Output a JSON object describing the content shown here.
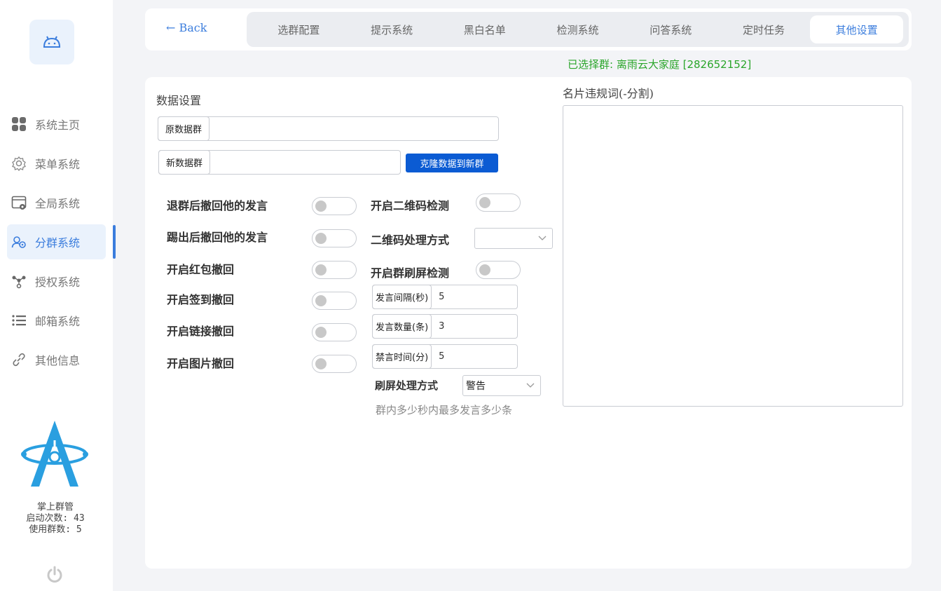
{
  "sidebar": {
    "items": [
      {
        "label": "系统主页",
        "icon": "grid-icon"
      },
      {
        "label": "菜单系统",
        "icon": "gear-icon"
      },
      {
        "label": "全局系统",
        "icon": "window-settings-icon"
      },
      {
        "label": "分群系统",
        "icon": "users-icon",
        "active": true
      },
      {
        "label": "授权系统",
        "icon": "network-icon"
      },
      {
        "label": "邮箱系统",
        "icon": "list-icon"
      },
      {
        "label": "其他信息",
        "icon": "link-icon"
      }
    ],
    "brand": {
      "name": "掌上群管",
      "launch_count": "启动次数: 43",
      "group_count": "使用群数: 5"
    }
  },
  "header": {
    "back_label": "← Back",
    "tabs": [
      "选群配置",
      "提示系统",
      "黑白名单",
      "检测系统",
      "问答系统",
      "定时任务",
      "其他设置"
    ],
    "active_tab": "其他设置",
    "selected_group": "已选择群: 离雨云大家庭 [282652152]"
  },
  "main": {
    "section_title": "数据设置",
    "source_group": {
      "label": "原数据群",
      "value": ""
    },
    "new_group": {
      "label": "新数据群",
      "value": ""
    },
    "clone_button": "克隆数据到新群",
    "left_toggles": [
      {
        "label": "退群后撤回他的发言",
        "on": false
      },
      {
        "label": "踢出后撤回他的发言",
        "on": false
      },
      {
        "label": "开启红包撤回",
        "on": false
      },
      {
        "label": "开启签到撤回",
        "on": false
      },
      {
        "label": "开启链接撤回",
        "on": false
      },
      {
        "label": "开启图片撤回",
        "on": false
      }
    ],
    "qr_detect_label": "开启二维码检测",
    "qr_mode_label": "二维码处理方式",
    "qr_mode_value": "",
    "flood_detect_label": "开启群刷屏检测",
    "interval": {
      "label": "发言间隔(秒)",
      "value": "5"
    },
    "count": {
      "label": "发言数量(条)",
      "value": "3"
    },
    "mute": {
      "label": "禁言时间(分)",
      "value": "5"
    },
    "flood_mode_label": "刷屏处理方式",
    "flood_mode_value": "警告",
    "flood_hint": "群内多少秒内最多发言多少条",
    "card_words_label": "名片违规词(-分割)",
    "card_words_value": ""
  },
  "colors": {
    "accent": "#3b7ddd",
    "primary_button": "#0b5bd3",
    "success_text": "#2aa52a"
  }
}
